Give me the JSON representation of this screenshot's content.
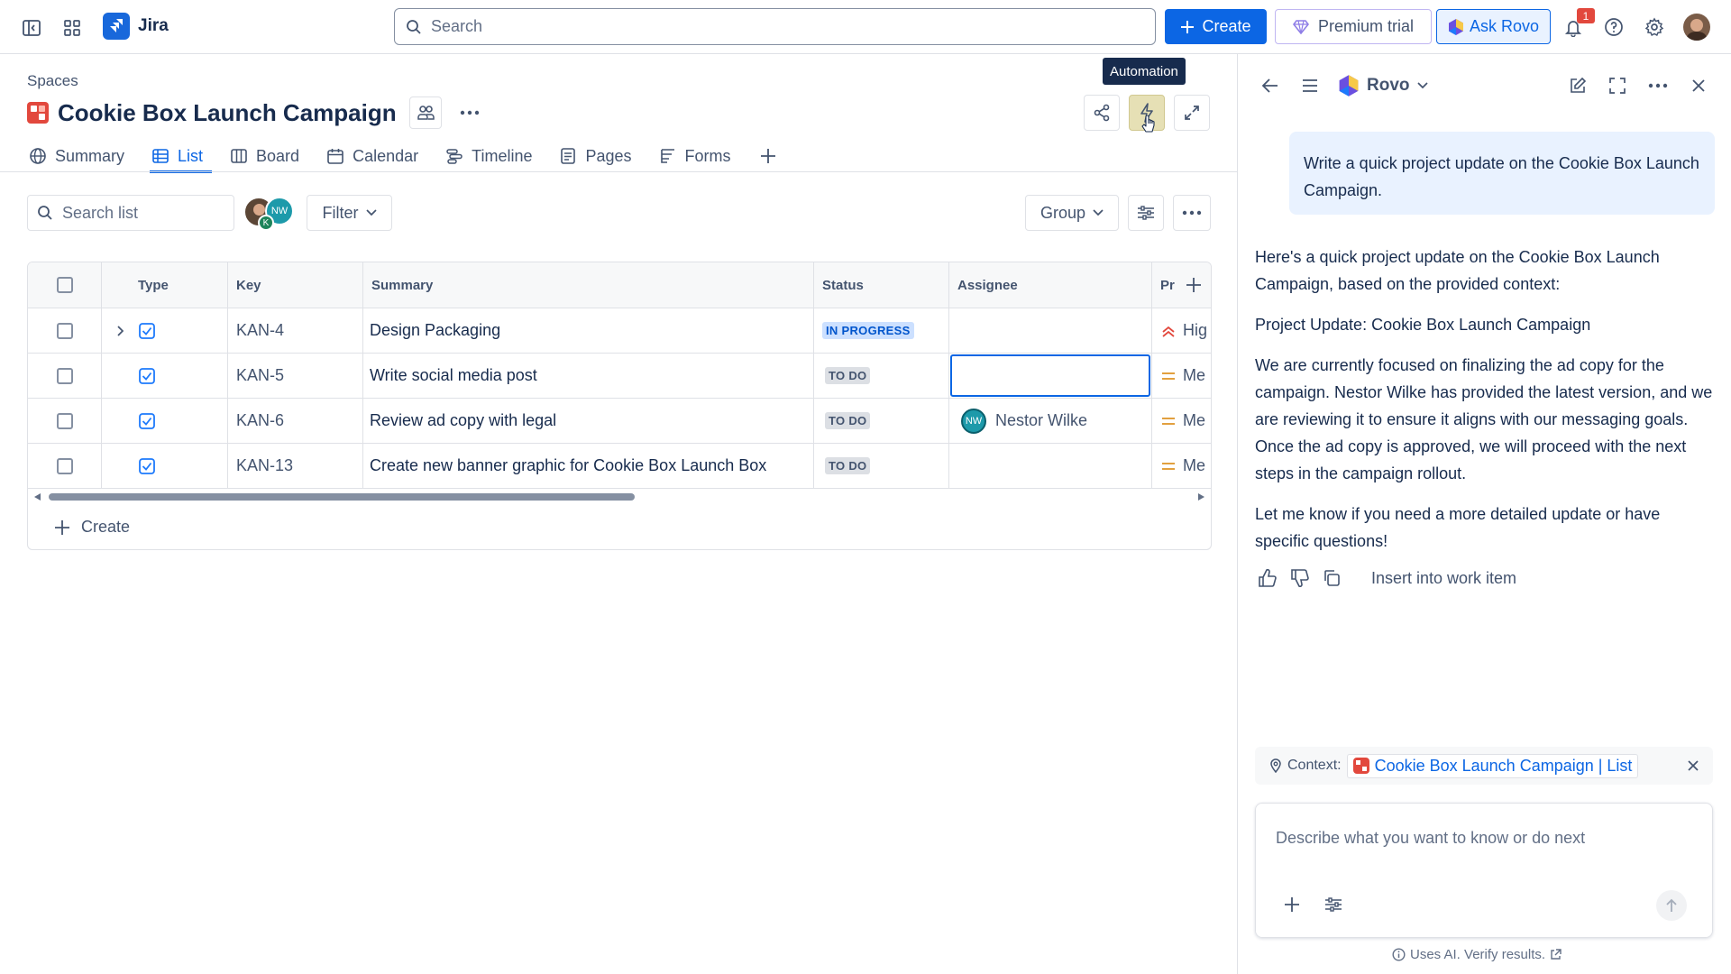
{
  "topbar": {
    "app_name": "Jira",
    "search_placeholder": "Search",
    "create_label": "Create",
    "premium_label": "Premium trial",
    "ask_rovo_label": "Ask Rovo",
    "notification_count": "1"
  },
  "project": {
    "breadcrumb": "Spaces",
    "title": "Cookie Box Launch Campaign",
    "tooltip": "Automation"
  },
  "tabs": [
    {
      "label": "Summary",
      "icon": "globe-icon"
    },
    {
      "label": "List",
      "icon": "list-icon",
      "active": true
    },
    {
      "label": "Board",
      "icon": "board-icon"
    },
    {
      "label": "Calendar",
      "icon": "calendar-icon"
    },
    {
      "label": "Timeline",
      "icon": "timeline-icon"
    },
    {
      "label": "Pages",
      "icon": "pages-icon"
    },
    {
      "label": "Forms",
      "icon": "forms-icon"
    }
  ],
  "toolbar": {
    "search_placeholder": "Search list",
    "filter_label": "Filter",
    "group_label": "Group",
    "avatar_initials_1": "K",
    "avatar_initials_2": "NW"
  },
  "table": {
    "columns": [
      "Type",
      "Key",
      "Summary",
      "Status",
      "Assignee",
      "Pr"
    ],
    "rows": [
      {
        "key": "KAN-4",
        "summary": "Design Packaging",
        "status": "IN PROGRESS",
        "assignee": "",
        "priority": "Hig"
      },
      {
        "key": "KAN-5",
        "summary": "Write social media post",
        "status": "TO DO",
        "assignee": "",
        "priority": "Me"
      },
      {
        "key": "KAN-6",
        "summary": "Review ad copy with legal",
        "status": "TO DO",
        "assignee": "Nestor Wilke",
        "assignee_initials": "NW",
        "priority": "Me"
      },
      {
        "key": "KAN-13",
        "summary": "Create new banner graphic for Cookie Box Launch Box",
        "status": "TO DO",
        "assignee": "",
        "priority": "Me"
      }
    ],
    "create_label": "Create"
  },
  "rovo": {
    "title": "Rovo",
    "user_message": "Write a quick project update on the Cookie Box Launch Campaign.",
    "ai_paragraphs": [
      "Here's a quick project update on the Cookie Box Launch Campaign, based on the provided context:",
      "Project Update: Cookie Box Launch Campaign",
      "We are currently focused on finalizing the ad copy for the campaign. Nestor Wilke has provided the latest version, and we are reviewing it to ensure it aligns with our messaging goals. Once the ad copy is approved, we will proceed with the next steps in the campaign rollout.",
      "Let me know if you need a more detailed update or have specific questions!"
    ],
    "insert_label": "Insert into work item",
    "context_label": "Context:",
    "context_link": "Cookie Box Launch Campaign | List",
    "composer_placeholder": "Describe what you want to know or do next",
    "footer": "Uses AI. Verify results."
  },
  "colors": {
    "brand_blue": "#0c66e4",
    "project_red": "#e2483d",
    "nw_avatar": "#1d9aaa"
  }
}
